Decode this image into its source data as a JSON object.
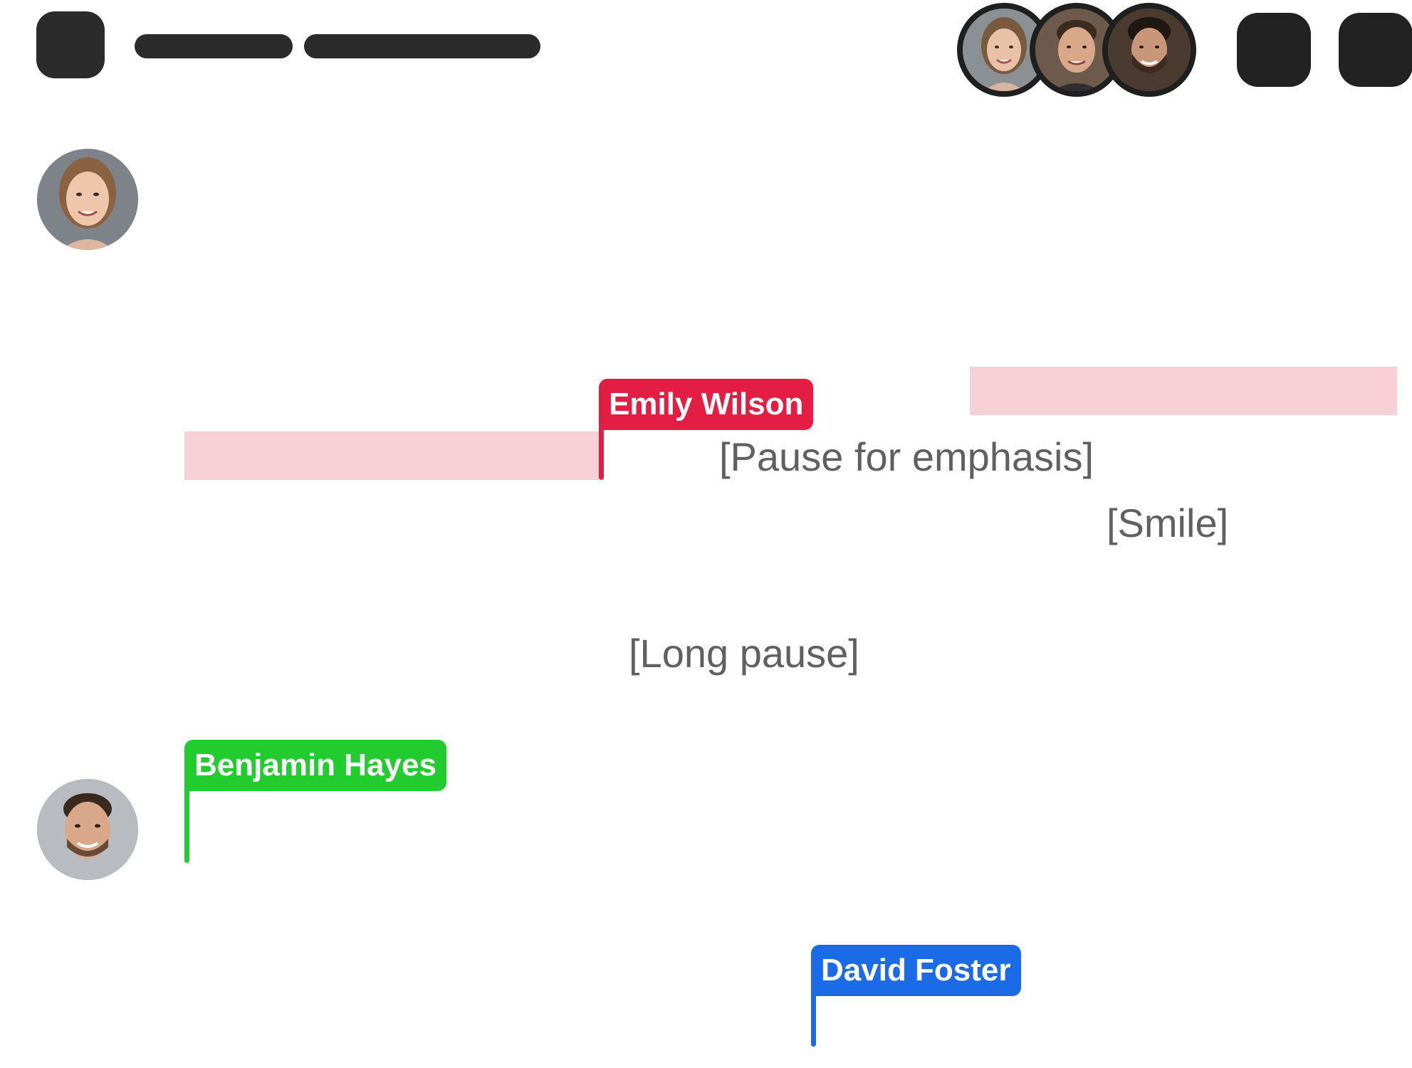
{
  "participants": [
    {
      "name": "Emily Wilson",
      "avatar": "woman-portrait"
    },
    {
      "name": "Benjamin Hayes",
      "avatar": "man-portrait"
    },
    {
      "name": "David Foster",
      "avatar": "man-bearded-portrait"
    }
  ],
  "cursors": {
    "emily": {
      "name": "Emily Wilson",
      "color": "#e31d44"
    },
    "benjamin": {
      "name": "Benjamin Hayes",
      "color": "#22cc2e"
    },
    "david": {
      "name": "David Foster",
      "color": "#1b6ae6"
    }
  },
  "directions": {
    "pause": "[Pause for emphasis]",
    "smile": "[Smile]",
    "long_pause": "[Long pause]"
  },
  "colors": {
    "highlight": "#f8d1d8",
    "dark_control": "#2b2b2b",
    "direction_text": "#606060"
  }
}
